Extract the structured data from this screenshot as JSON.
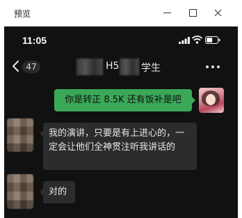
{
  "window": {
    "title": "预览"
  },
  "status_bar": {
    "time": "11:05"
  },
  "nav": {
    "unread_count": "47",
    "title_part_a": "H5",
    "title_part_b": "学生"
  },
  "messages": [
    {
      "sender": "me",
      "text": "你是转正 8.5K 还有饭补是吧"
    },
    {
      "sender": "other",
      "text": "我的演讲，只要是有上进心的，一定会让他们全神贯注听我讲话的"
    },
    {
      "sender": "other",
      "text": "对的"
    }
  ],
  "colors": {
    "my_bubble": "#3aa857",
    "other_bubble": "#2c2c2c",
    "chat_background": "#111111"
  }
}
